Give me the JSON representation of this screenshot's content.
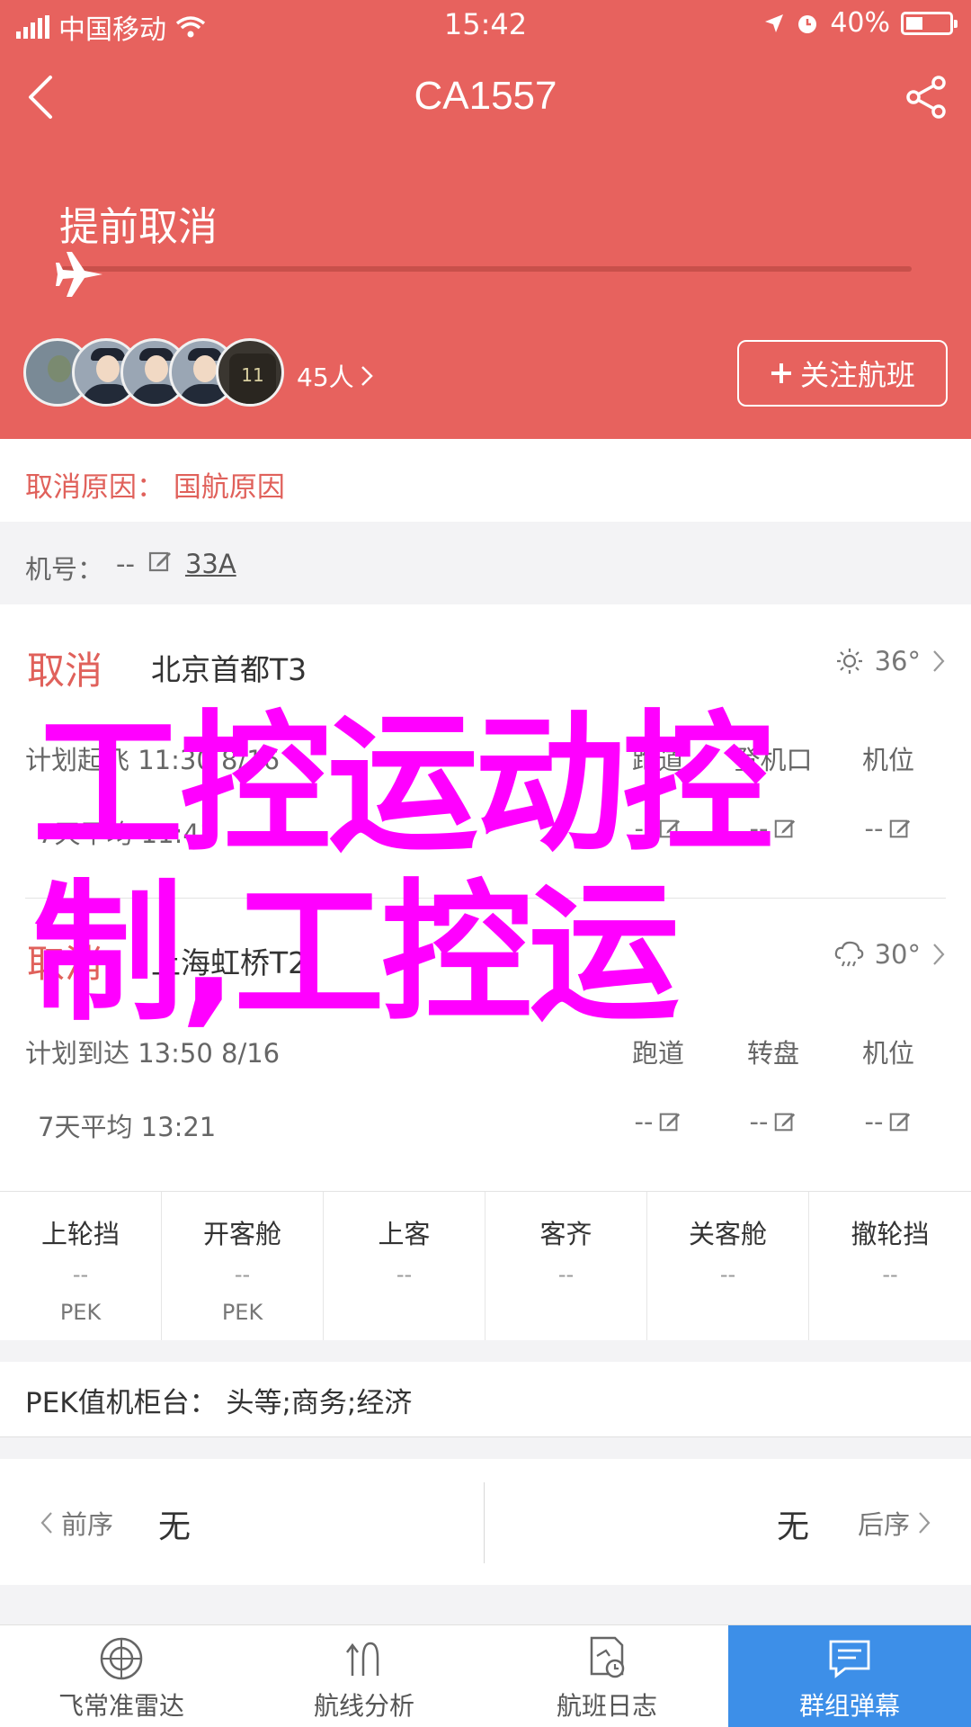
{
  "status_bar": {
    "carrier": "中国移动",
    "time": "15:42",
    "battery": "40%"
  },
  "nav": {
    "title": "CA1557"
  },
  "flight": {
    "status": "提前取消",
    "followers": "45人",
    "follow_label": "关注航班"
  },
  "cancel_reason": "取消原因： 国航原因",
  "aircraft": {
    "label": "机号：",
    "value": "--",
    "registration": "33A"
  },
  "departure": {
    "state": "取消",
    "airport": "北京首都T3",
    "temperature": "36°",
    "plan": "计划起飞 11:30 8/16",
    "avg": "7天平均 11:41",
    "cols": [
      "跑道",
      "登机口",
      "机位"
    ],
    "vals": [
      "--",
      "--",
      "--"
    ]
  },
  "arrival": {
    "state": "取消",
    "airport": "上海虹桥T2",
    "temperature": "30°",
    "plan": "计划到达 13:50 8/16",
    "avg": "7天平均 13:21",
    "cols": [
      "跑道",
      "转盘",
      "机位"
    ],
    "vals": [
      "--",
      "--",
      "--"
    ]
  },
  "watermark": {
    "line1": "工控运动控",
    "line2": "制,工控运"
  },
  "timeline": [
    {
      "label": "上轮挡",
      "value": "--",
      "loc": "PEK"
    },
    {
      "label": "开客舱",
      "value": "--",
      "loc": "PEK"
    },
    {
      "label": "上客",
      "value": "--",
      "loc": ""
    },
    {
      "label": "客齐",
      "value": "--",
      "loc": ""
    },
    {
      "label": "关客舱",
      "value": "--",
      "loc": ""
    },
    {
      "label": "撤轮挡",
      "value": "--",
      "loc": ""
    }
  ],
  "checkin": "PEK值机柜台： 头等;商务;经济",
  "sequence": {
    "prev_label": "前序",
    "prev_value": "无",
    "next_value": "无",
    "next_label": "后序"
  },
  "tabs": [
    {
      "label": "飞常准雷达",
      "icon": "radar-icon"
    },
    {
      "label": "航线分析",
      "icon": "route-icon"
    },
    {
      "label": "航班日志",
      "icon": "log-icon"
    },
    {
      "label": "群组弹幕",
      "icon": "chat-icon"
    }
  ],
  "colors": {
    "header": "#e7625e",
    "accent_red": "#e0615b",
    "tab_active": "#3d8fe8",
    "watermark": "#ff00ff"
  }
}
